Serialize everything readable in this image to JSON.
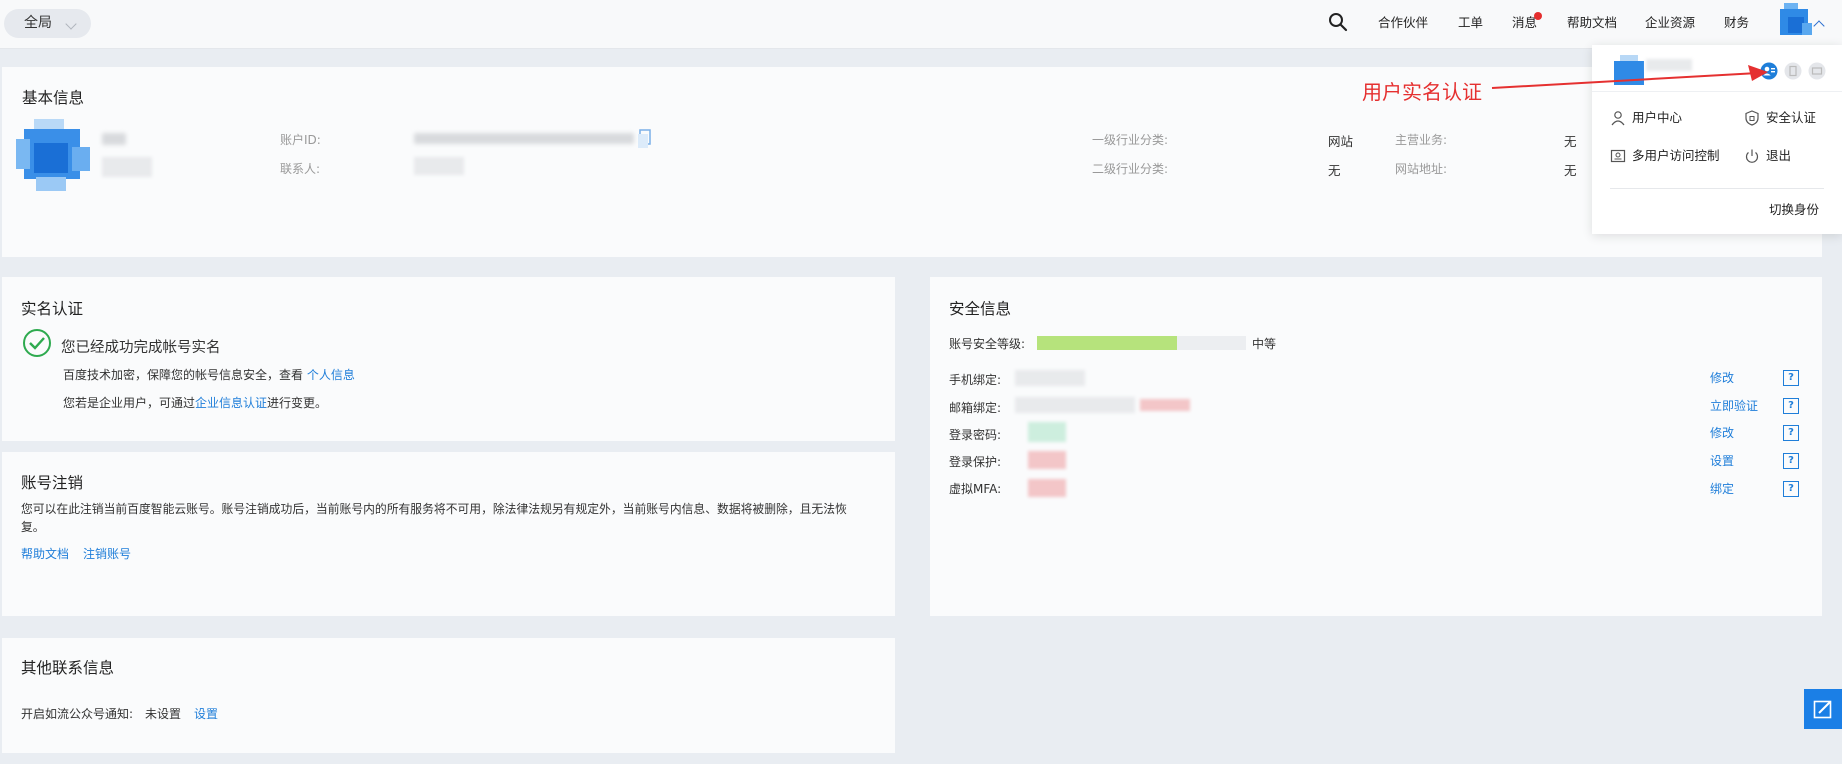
{
  "topbar": {
    "scope_label": "全局",
    "nav": [
      "合作伙伴",
      "工单",
      "消息",
      "帮助文档",
      "企业资源",
      "财务"
    ],
    "search_icon": "search-icon",
    "unread_dot_color": "#e42e2e"
  },
  "basic_info": {
    "title": "基本信息",
    "account_id_label": "账户ID:",
    "contact_label": "联系人:",
    "industry1_label": "一级行业分类:",
    "industry1_value": "网站",
    "industry2_label": "二级行业分类:",
    "industry2_value": "无",
    "main_business_label": "主营业务:",
    "main_business_value": "无",
    "website_label": "网站地址:",
    "website_value": "无"
  },
  "realname": {
    "title": "实名认证",
    "status": "您已经成功完成帐号实名",
    "desc": "百度技术加密，保障您的帐号信息安全，查看",
    "desc_link": "个人信息",
    "enterprise_prefix": "您若是企业用户，可通过",
    "enterprise_link": "企业信息认证",
    "enterprise_suffix": "进行变更。"
  },
  "cancel_account": {
    "title": "账号注销",
    "desc_line1": "您可以在此注销当前百度智能云账号。账号注销成功后，当前账号内的所有服务将不可用，除法律法规另有规定外，当前账号内信息、数据将被删除，且无法恢",
    "desc_line2": "复。",
    "help_link": "帮助文档",
    "cancel_link": "注销账号"
  },
  "other_contact": {
    "title": "其他联系信息",
    "label": "开启如流公众号通知:",
    "value": "未设置",
    "action": "设置"
  },
  "security": {
    "title": "安全信息",
    "level_label": "账号安全等级:",
    "level_value": "中等",
    "level_fraction": 0.67,
    "bar_color": "#b6e37c",
    "rows": [
      {
        "label": "手机绑定:",
        "action": "修改"
      },
      {
        "label": "邮箱绑定:",
        "action": "立即验证"
      },
      {
        "label": "登录密码:",
        "action": "修改"
      },
      {
        "label": "登录保护:",
        "action": "设置"
      },
      {
        "label": "虚拟MFA:",
        "action": "绑定"
      }
    ],
    "help_mark": "?"
  },
  "dropdown": {
    "items": {
      "user_center": "用户中心",
      "security_auth": "安全认证",
      "multi_user": "多用户访问控制",
      "logout": "退出"
    },
    "switch_identity": "切换身份"
  },
  "annotation": {
    "text": "用户实名认证",
    "color": "#e53030"
  },
  "colors": {
    "accent": "#1f7ed9",
    "success": "#2eaa4f",
    "feedback": "#1b7fe6"
  }
}
